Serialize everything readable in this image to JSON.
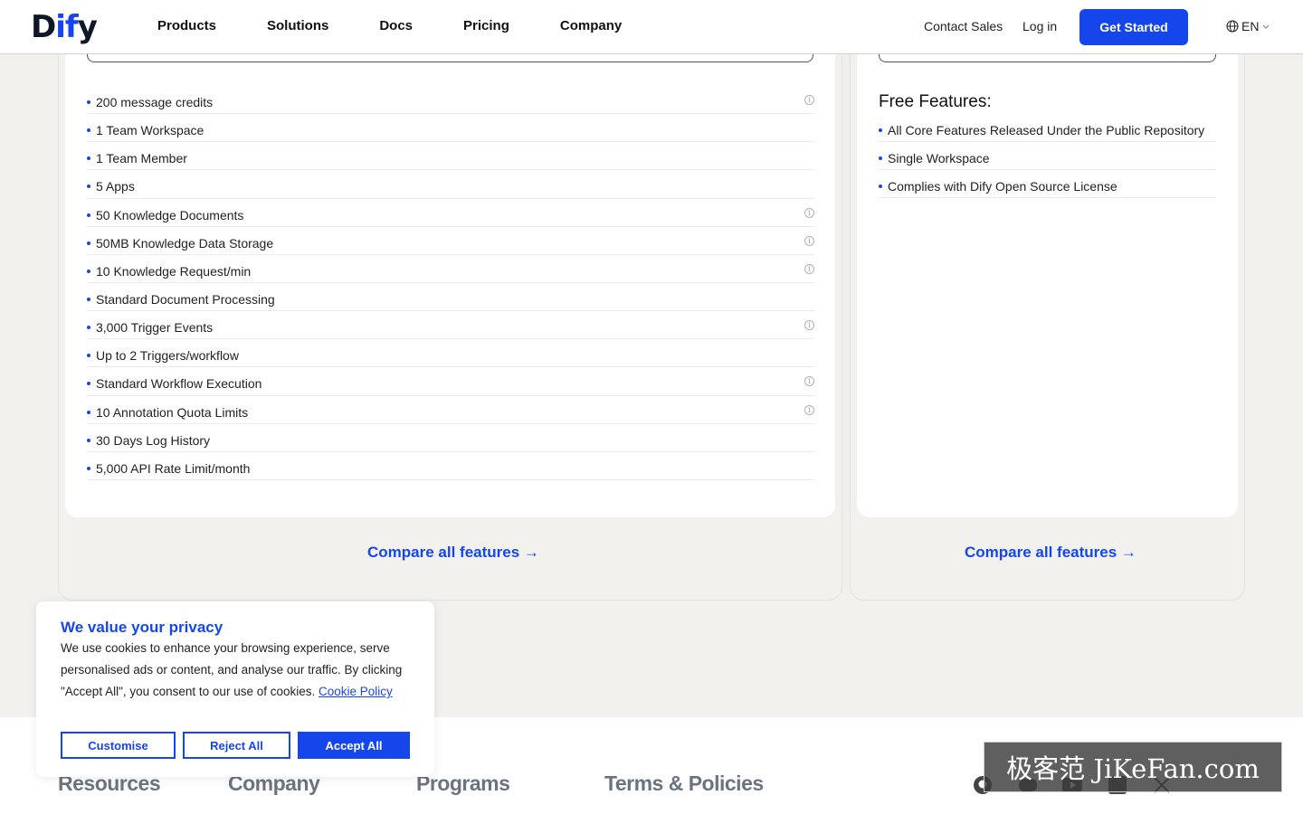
{
  "header": {
    "logo_text_a": "D",
    "logo_text_b": "if",
    "logo_text_c": "y",
    "nav": [
      "Products",
      "Solutions",
      "Docs",
      "Pricing",
      "Company"
    ],
    "contact_sales": "Contact Sales",
    "login": "Log in",
    "get_started": "Get Started",
    "language": "EN"
  },
  "plan_left": {
    "features": [
      {
        "text": "200 message credits",
        "info": true
      },
      {
        "text": "1 Team Workspace",
        "info": false
      },
      {
        "text": "1 Team Member",
        "info": false
      },
      {
        "text": "5 Apps",
        "info": false
      },
      {
        "text": "50 Knowledge Documents",
        "info": true
      },
      {
        "text": "50MB Knowledge Data Storage",
        "info": true
      },
      {
        "text": "10 Knowledge Request/min",
        "info": true
      },
      {
        "text": "Standard Document Processing",
        "info": false
      },
      {
        "text": "3,000 Trigger Events",
        "info": true
      },
      {
        "text": "Up to 2 Triggers/workflow",
        "info": false
      },
      {
        "text": "Standard Workflow Execution",
        "info": true
      },
      {
        "text": "10 Annotation Quota Limits",
        "info": true
      },
      {
        "text": "30 Days Log History",
        "info": false
      },
      {
        "text": "5,000 API Rate Limit/month",
        "info": false
      }
    ],
    "compare": "Compare all features"
  },
  "plan_right": {
    "title": "Free Features:",
    "features": [
      "All Core Features Released Under the Public Repository",
      "Single Workspace",
      "Complies with Dify Open Source License"
    ],
    "compare": "Compare all features"
  },
  "footer": {
    "headings": [
      "Resources",
      "Company",
      "Programs",
      "Terms & Policies"
    ],
    "social_icons": [
      "github-icon",
      "discord-icon",
      "youtube-icon",
      "linkedin-icon",
      "x-icon"
    ]
  },
  "cookie": {
    "title": "We value your privacy",
    "body": "We use cookies to enhance your browsing experience, serve personalised ads or content, and analyse our traffic. By clicking \"Accept All\", you consent to our use of cookies.",
    "policy_link": "Cookie Policy",
    "customise": "Customise",
    "reject": "Reject All",
    "accept": "Accept All"
  },
  "watermark": "极客范 JiKeFan.com",
  "colors": {
    "accent": "#1546ec",
    "background": "#f2f0ed"
  }
}
